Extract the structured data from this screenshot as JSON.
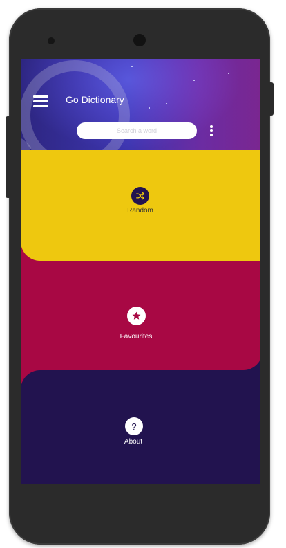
{
  "app": {
    "title": "Go Dictionary"
  },
  "search": {
    "placeholder": "Search a word"
  },
  "panels": {
    "random": {
      "label": "Random",
      "icon": "shuffle-icon",
      "color": "#eec80f"
    },
    "favourites": {
      "label": "Favourites",
      "icon": "star-icon",
      "color": "#a80844"
    },
    "about": {
      "label": "About",
      "icon": "question-icon",
      "glyph": "?",
      "color": "#22134f"
    }
  },
  "colors": {
    "header_start": "#151346",
    "header_end": "#6b145e",
    "device": "#2b2b2b"
  }
}
